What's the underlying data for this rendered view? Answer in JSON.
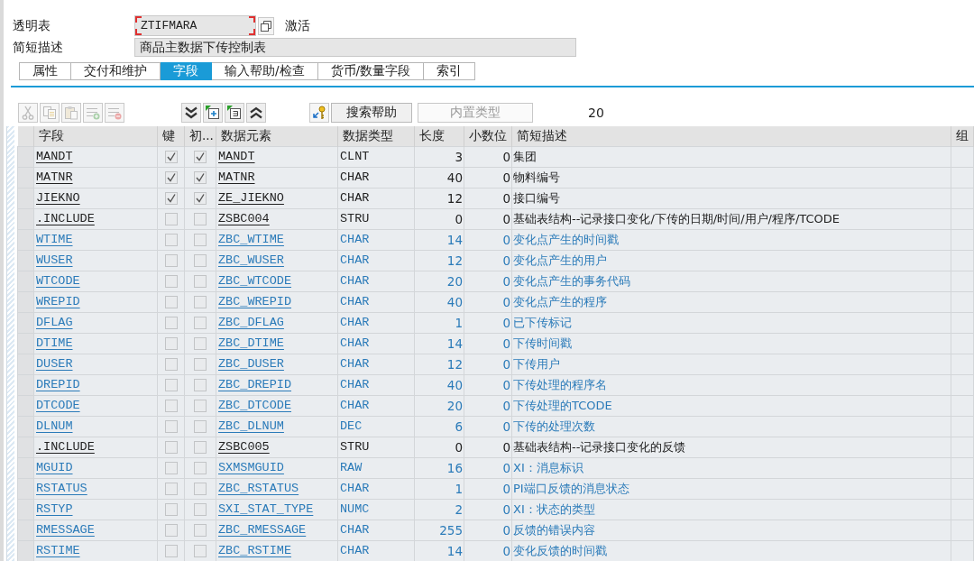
{
  "header": {
    "table_label": "透明表",
    "table_name": {
      "value": "ZTIFMARA",
      "focused": true
    },
    "status": "激活",
    "description_label": "简短描述",
    "description": "商品主数据下传控制表"
  },
  "tabs": [
    {
      "label": "属性",
      "selected": false
    },
    {
      "label": "交付和维护",
      "selected": false
    },
    {
      "label": "字段",
      "selected": true
    },
    {
      "label": "输入帮助/检查",
      "selected": false
    },
    {
      "label": "货币/数量字段",
      "selected": false
    },
    {
      "label": "索引",
      "selected": false
    }
  ],
  "toolbar": {
    "edit_buttons": [
      {
        "disabled": true
      },
      {
        "disabled": true
      },
      {
        "disabled": true
      },
      {
        "disabled": true
      },
      {
        "disabled": true
      }
    ],
    "outline_buttons": [
      {
        "disabled": false
      },
      {
        "disabled": false
      },
      {
        "disabled": false
      },
      {
        "disabled": false
      }
    ],
    "search_help_button": {
      "label": "搜索帮助"
    },
    "builtin_type_button": {
      "label": "内置类型",
      "disabled": true
    },
    "count": "20"
  },
  "table": {
    "columns": [
      "字段",
      "键",
      "初...",
      "数据元素",
      "数据类型",
      "长度",
      "小数位",
      "简短描述",
      "组"
    ],
    "rows": [
      {
        "field": "MANDT",
        "key": true,
        "initial": true,
        "data_element": "MANDT",
        "data_type": "CLNT",
        "length": "3",
        "decimals": "0",
        "description": "集团",
        "included": false
      },
      {
        "field": "MATNR",
        "key": true,
        "initial": true,
        "data_element": "MATNR",
        "data_type": "CHAR",
        "length": "40",
        "decimals": "0",
        "description": "物料编号",
        "included": false
      },
      {
        "field": "JIEKNO",
        "key": true,
        "initial": true,
        "data_element": "ZE_JIEKNO",
        "data_type": "CHAR",
        "length": "12",
        "decimals": "0",
        "description": "接口编号",
        "included": false
      },
      {
        "field": ".INCLUDE",
        "key": false,
        "initial": false,
        "data_element": "ZSBC004",
        "data_type": "STRU",
        "length": "0",
        "decimals": "0",
        "description": "基础表结构--记录接口变化/下传的日期/时间/用户/程序/TCODE",
        "included": false
      },
      {
        "field": "WTIME",
        "key": false,
        "initial": false,
        "data_element": "ZBC_WTIME",
        "data_type": "CHAR",
        "length": "14",
        "decimals": "0",
        "description": "变化点产生的时间戳",
        "included": true
      },
      {
        "field": "WUSER",
        "key": false,
        "initial": false,
        "data_element": "ZBC_WUSER",
        "data_type": "CHAR",
        "length": "12",
        "decimals": "0",
        "description": "变化点产生的用户",
        "included": true
      },
      {
        "field": "WTCODE",
        "key": false,
        "initial": false,
        "data_element": "ZBC_WTCODE",
        "data_type": "CHAR",
        "length": "20",
        "decimals": "0",
        "description": "变化点产生的事务代码",
        "included": true
      },
      {
        "field": "WREPID",
        "key": false,
        "initial": false,
        "data_element": "ZBC_WREPID",
        "data_type": "CHAR",
        "length": "40",
        "decimals": "0",
        "description": "变化点产生的程序",
        "included": true
      },
      {
        "field": "DFLAG",
        "key": false,
        "initial": false,
        "data_element": "ZBC_DFLAG",
        "data_type": "CHAR",
        "length": "1",
        "decimals": "0",
        "description": "已下传标记",
        "included": true
      },
      {
        "field": "DTIME",
        "key": false,
        "initial": false,
        "data_element": "ZBC_DTIME",
        "data_type": "CHAR",
        "length": "14",
        "decimals": "0",
        "description": "下传时间戳",
        "included": true
      },
      {
        "field": "DUSER",
        "key": false,
        "initial": false,
        "data_element": "ZBC_DUSER",
        "data_type": "CHAR",
        "length": "12",
        "decimals": "0",
        "description": "下传用户",
        "included": true
      },
      {
        "field": "DREPID",
        "key": false,
        "initial": false,
        "data_element": "ZBC_DREPID",
        "data_type": "CHAR",
        "length": "40",
        "decimals": "0",
        "description": "下传处理的程序名",
        "included": true
      },
      {
        "field": "DTCODE",
        "key": false,
        "initial": false,
        "data_element": "ZBC_DTCODE",
        "data_type": "CHAR",
        "length": "20",
        "decimals": "0",
        "description": "下传处理的TCODE",
        "included": true
      },
      {
        "field": "DLNUM",
        "key": false,
        "initial": false,
        "data_element": "ZBC_DLNUM",
        "data_type": "DEC",
        "length": "6",
        "decimals": "0",
        "description": "下传的处理次数",
        "included": true
      },
      {
        "field": ".INCLUDE",
        "key": false,
        "initial": false,
        "data_element": "ZSBC005",
        "data_type": "STRU",
        "length": "0",
        "decimals": "0",
        "description": "基础表结构--记录接口变化的反馈",
        "included": false
      },
      {
        "field": "MGUID",
        "key": false,
        "initial": false,
        "data_element": "SXMSMGUID",
        "data_type": "RAW",
        "length": "16",
        "decimals": "0",
        "description": "XI：消息标识",
        "included": true
      },
      {
        "field": "RSTATUS",
        "key": false,
        "initial": false,
        "data_element": "ZBC_RSTATUS",
        "data_type": "CHAR",
        "length": "1",
        "decimals": "0",
        "description": "PI端口反馈的消息状态",
        "included": true
      },
      {
        "field": "RSTYP",
        "key": false,
        "initial": false,
        "data_element": "SXI_STAT_TYPE",
        "data_type": "NUMC",
        "length": "2",
        "decimals": "0",
        "description": "XI：状态的类型",
        "included": true
      },
      {
        "field": "RMESSAGE",
        "key": false,
        "initial": false,
        "data_element": "ZBC_RMESSAGE",
        "data_type": "CHAR",
        "length": "255",
        "decimals": "0",
        "description": "反馈的错误内容",
        "included": true
      },
      {
        "field": "RSTIME",
        "key": false,
        "initial": false,
        "data_element": "ZBC_RSTIME",
        "data_type": "CHAR",
        "length": "14",
        "decimals": "0",
        "description": "变化反馈的时间戳",
        "included": true
      }
    ]
  }
}
